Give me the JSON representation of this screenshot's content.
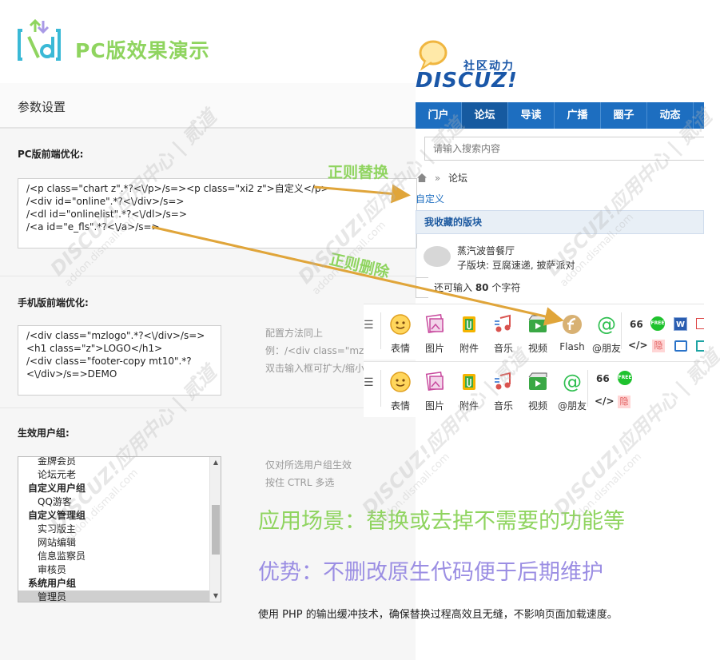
{
  "header": {
    "title": "PC版效果演示"
  },
  "settings": {
    "title": "参数设置",
    "pc_section_label": "PC版前端优化:",
    "pc_code": "/<p class=\"chart z\".*?<\\/p>/s=><p class=\"xi2 z\">自定义</p>\n/<div id=\"online\".*?<\\/div>/s=>\n/<dl id=\"onlinelist\".*?<\\/dl>/s=>\n/<a id=\"e_fls\".*?<\\/a>/s=>",
    "mobile_section_label": "手机版前端优化:",
    "mobile_code": "/<div class=\"mzlogo\".*?<\\/div>/s=>\n<h1 class=\"z\">LOGO</h1>\n/<div class=\"footer-copy mt10\".*?\n<\\/div>/s=>DEMO",
    "mobile_hint_1": "配置方法同上",
    "mobile_hint_2": "例：/<div class=\"mzl",
    "mobile_hint_3": "双击输入框可扩大/缩小",
    "groups_section_label": "生效用户组:",
    "groups_hint_1": "仅对所选用户组生效",
    "groups_hint_2": "按住 CTRL 多选",
    "group_options": [
      {
        "label": "金牌会员",
        "kind": "item"
      },
      {
        "label": "论坛元老",
        "kind": "item"
      },
      {
        "label": "自定义用户组",
        "kind": "group"
      },
      {
        "label": "QQ游客",
        "kind": "item"
      },
      {
        "label": "自定义管理组",
        "kind": "group"
      },
      {
        "label": "实习版主",
        "kind": "item"
      },
      {
        "label": "网站编辑",
        "kind": "item"
      },
      {
        "label": "信息监察员",
        "kind": "item"
      },
      {
        "label": "审核员",
        "kind": "item"
      },
      {
        "label": "系统用户组",
        "kind": "group"
      },
      {
        "label": "管理员",
        "kind": "item",
        "selected": true
      }
    ]
  },
  "discuz": {
    "logo_cn": "社区动力",
    "logo_word": "DISCUZ!",
    "nav": [
      "门户",
      "论坛",
      "导读",
      "广播",
      "圈子",
      "动态"
    ],
    "nav_active": "论坛",
    "search_placeholder": "请输入搜索内容",
    "breadcrumb_sep": "»",
    "breadcrumb": "论坛",
    "custom_label": "自定义",
    "fav_title": "我收藏的版块",
    "fav_name": "蒸汽波普餐厅",
    "fav_sub": "子版块: 豆腐速递, 披萨派对",
    "remain_pre": "还可输入 ",
    "remain_num": "80",
    "remain_post": " 个字符",
    "toolbar1": [
      "表情",
      "图片",
      "附件",
      "音乐",
      "视频",
      "Flash",
      "@朋友"
    ],
    "toolbar2": [
      "表情",
      "图片",
      "附件",
      "音乐",
      "视频",
      "@朋友"
    ],
    "quote_glyph": "66",
    "code_glyph": "</>",
    "hide_glyph": "隐",
    "free_badge": "FREE",
    "word_badge": "W"
  },
  "annotations": {
    "replace": "正则替换",
    "delete": "正则删除"
  },
  "taglines": {
    "scene": "应用场景：替换或去掉不需要的功能等",
    "advantage": "优势：不删改原生代码便于后期维护",
    "note": "使用 PHP 的输出缓冲技术，确保替换过程高效且无缝，不影响页面加载速度。"
  },
  "watermark": {
    "text": "DISCUZ!应用中心 | 贰道",
    "url": "addon.dismall.com"
  },
  "colors": {
    "green": "#8fd45f",
    "purple": "#9b8ee3",
    "nav_blue": "#1d6ec0",
    "arrow": "#e0a53a"
  }
}
